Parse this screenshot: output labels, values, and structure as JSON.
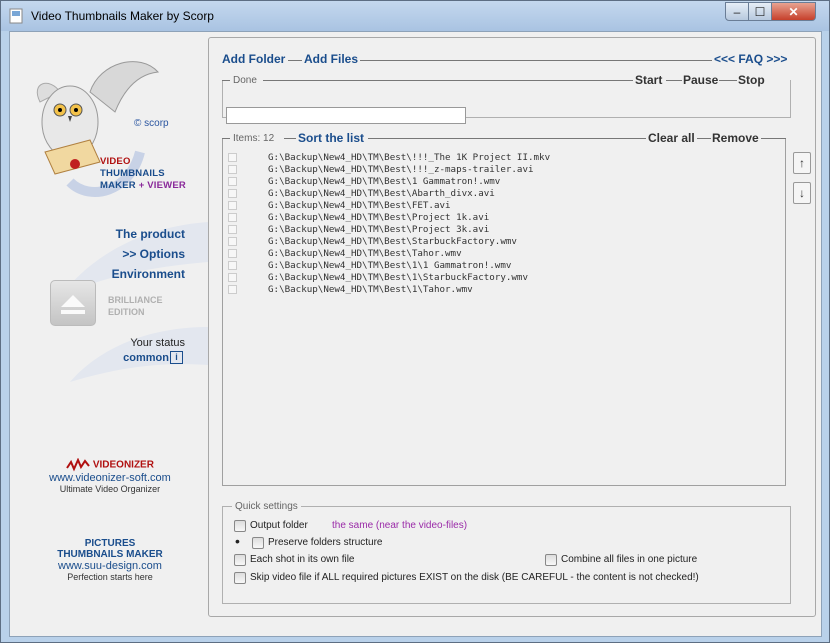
{
  "window": {
    "title": "Video Thumbnails Maker by Scorp",
    "min": "–",
    "max": "☐",
    "close": "✕"
  },
  "sidebar": {
    "credit": "© scorp",
    "brand_line1": "VIDEO",
    "brand_line2": "THUMBNAILS",
    "brand_line3a": "MAKER",
    "brand_line3b": "+ VIEWER",
    "nav": {
      "product": "The product",
      "options": ">> Options",
      "environment": "Environment"
    },
    "brilliance_line1": "BRILLIANCE",
    "brilliance_line2": "EDITION",
    "status_label": "Your status",
    "status_value": "common",
    "ad1": {
      "title": "VIDEONIZER",
      "url": "www.videonizer-soft.com",
      "slogan": "Ultimate Video Organizer"
    },
    "ad2": {
      "title1": "PICTURES",
      "title2": "THUMBNAILS MAKER",
      "url": "www.suu-design.com",
      "slogan": "Perfection starts here"
    }
  },
  "toolbar": {
    "add_folder": "Add Folder",
    "add_files": "Add Files",
    "faq": "<<< FAQ >>>"
  },
  "progress": {
    "status": "Done",
    "start": "Start",
    "pause": "Pause",
    "stop": "Stop",
    "value": 0
  },
  "list": {
    "count_label": "Items: 12",
    "sort": "Sort the list",
    "clear": "Clear all",
    "remove": "Remove",
    "up": "↑",
    "down": "↓",
    "items": [
      "G:\\Backup\\New4_HD\\TM\\Best\\!!!_The 1K Project II.mkv",
      "G:\\Backup\\New4_HD\\TM\\Best\\!!!_z-maps-trailer.avi",
      "G:\\Backup\\New4_HD\\TM\\Best\\1 Gammatron!.wmv",
      "G:\\Backup\\New4_HD\\TM\\Best\\Abarth_divx.avi",
      "G:\\Backup\\New4_HD\\TM\\Best\\FET.avi",
      "G:\\Backup\\New4_HD\\TM\\Best\\Project 1k.avi",
      "G:\\Backup\\New4_HD\\TM\\Best\\Project 3k.avi",
      "G:\\Backup\\New4_HD\\TM\\Best\\StarbuckFactory.wmv",
      "G:\\Backup\\New4_HD\\TM\\Best\\Tahor.wmv",
      "G:\\Backup\\New4_HD\\TM\\Best\\1\\1 Gammatron!.wmv",
      "G:\\Backup\\New4_HD\\TM\\Best\\1\\StarbuckFactory.wmv",
      "G:\\Backup\\New4_HD\\TM\\Best\\1\\Tahor.wmv"
    ]
  },
  "quick": {
    "title": "Quick settings",
    "output_folder": "Output  folder",
    "output_value": "the same (near the video-files)",
    "bullet": "•",
    "preserve": "Preserve folders structure",
    "each_shot": "Each shot in its own file",
    "combine": "Combine all files in one picture",
    "skip": "Skip video file if ALL required pictures EXIST on the disk (BE CAREFUL - the content is not checked!)"
  }
}
